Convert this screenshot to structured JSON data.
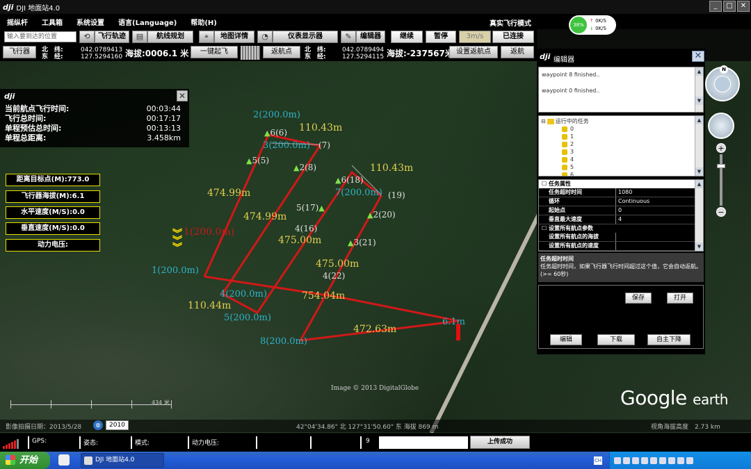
{
  "window": {
    "logo": "dji",
    "title": "DJI 地面站4.0",
    "min": "_",
    "max": "□",
    "close": "✕",
    "mode": "真实飞行模式"
  },
  "menu": [
    "摇纵杆",
    "工具箱",
    "系统设置",
    "语言(Language)",
    "帮助(H)"
  ],
  "battery": {
    "percent": "38%",
    "up": "0K/S",
    "down": "0K/S"
  },
  "toolbar1": {
    "search_placeholder": "输入要到达的位置",
    "flight_track": "飞行轨迹",
    "route_plan": "航线规划",
    "map_detail": "地图详情",
    "instrument": "仪表显示器",
    "editor": "编辑器",
    "continue": "继续",
    "pause": "暂停",
    "speed": "3m/s",
    "connected": "已连接"
  },
  "toolbar2": {
    "aircraft": "飞行器",
    "lat_label": "北　纬:",
    "lon_label": "东　经:",
    "lat": "042.0789413",
    "lon": "127.5294160",
    "alt": "海拔:0006.1 米",
    "takeoff": "一键起飞",
    "return_home": "返航点",
    "lat2": "042.0789494",
    "lon2": "127.5294115",
    "alt2": "海拔:-237567米",
    "set_home": "设置返航点",
    "go_home": "返航"
  },
  "info": {
    "logo": "dji",
    "close": "✕",
    "rows": [
      {
        "k": "当前航点飞行时间:",
        "v": "00:03:44"
      },
      {
        "k": "飞行总时间:",
        "v": "00:17:17"
      },
      {
        "k": "单程预估总时间:",
        "v": "00:13:13"
      },
      {
        "k": "单程总距离:",
        "v": "3.458km"
      }
    ]
  },
  "status_boxes": [
    "距离目标点(M):773.0",
    "飞行器海拔(M):6.1",
    "水平速度(M/S):0.0",
    "垂直速度(M/S):0.0",
    "动力电压:"
  ],
  "map": {
    "waypoints": [
      {
        "label": "2(200.0m)"
      },
      {
        "label": "3(200.0m)"
      },
      {
        "label": "1(200.0m)"
      },
      {
        "label": "4(200.0m)"
      },
      {
        "label": "5(200.0m)"
      },
      {
        "label": "7(200.0m)"
      },
      {
        "label": "8(200.0m)"
      },
      {
        "label": "6.1m"
      }
    ],
    "red_label": "1(200.0m)",
    "distances": [
      "110.43m",
      "474.99m",
      "474.99m",
      "110.43m",
      "475.00m",
      "475.00m",
      "110.44m",
      "754.04m",
      "472.63m"
    ],
    "markers": [
      "6(6)",
      "(7)",
      "5(5)",
      "2(8)",
      "6(18)",
      "(19)",
      "5(17)",
      "2(20)",
      "4(16)",
      "3(21)",
      "4(22)"
    ],
    "copyright": "Image © 2013 DigitalGlobe",
    "scale": "434 米",
    "image_date": "影像拍摄日期：2013/5/28",
    "year": "2010",
    "center": "42°04'34.86\" 北 127°31'50.60\" 东 海拔 869 m",
    "eye": "视角海拔高度　2.73 km",
    "brand": "Google",
    "brand2": "earth"
  },
  "editor": {
    "logo": "dji",
    "title": "编辑器",
    "close": "✕",
    "log": [
      "waypoint 8 finished..",
      "waypoint 0 finished.."
    ],
    "tree_root": "运行中的任务",
    "tree_nodes": [
      "0",
      "1",
      "2",
      "3",
      "4",
      "5",
      "6"
    ],
    "section1": "任务属性",
    "props": [
      {
        "k": "任务超时时间",
        "v": "1080"
      },
      {
        "k": "循环",
        "v": "Continuous"
      },
      {
        "k": "起始点",
        "v": "0"
      },
      {
        "k": "垂直最大速度",
        "v": "4"
      }
    ],
    "section2": "设置所有航点参数",
    "sub1": "设置所有航点的海拔",
    "sub2": "设置所有航点的速度",
    "desc_title": "任务超时时间",
    "desc_text": "任务超时时间，如果飞行器飞行时间超过这个值，它会自动返航。(>= 60秒)",
    "save": "保存",
    "open": "打开",
    "edit": "编辑",
    "download": "下载",
    "land": "自主下降"
  },
  "statusbar": {
    "gps": "GPS:",
    "attitude": "姿态:",
    "mode": "模式:",
    "voltage": "动力电压:",
    "count": "9",
    "upload": "上传成功"
  },
  "taskbar": {
    "start": "开始",
    "item": "DJI 地面站4.0",
    "kb": "CH"
  },
  "colors": {
    "route": "#d11818",
    "waypoint": "#2fb3c9",
    "distance": "#e3cf52",
    "box_border": "#e8e000"
  }
}
